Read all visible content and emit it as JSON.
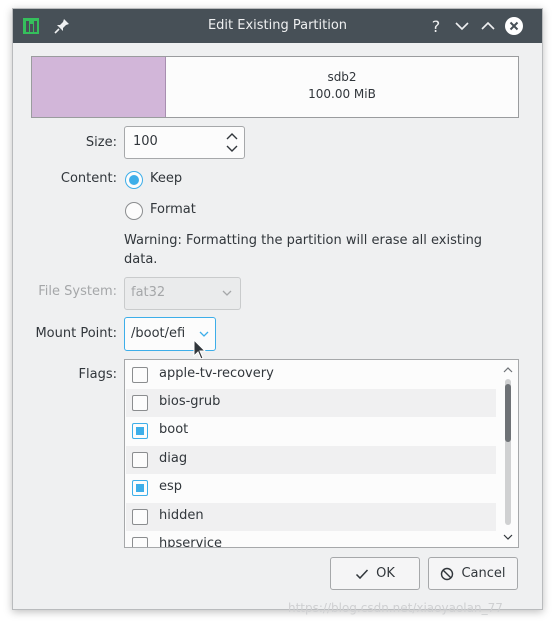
{
  "window": {
    "title": "Edit Existing Partition",
    "help": "?"
  },
  "partition": {
    "name": "sdb2",
    "size_label": "100.00 MiB",
    "fill_fraction": 0.27,
    "fill_color": "#d2b6d9"
  },
  "size": {
    "label": "Size:",
    "value": "100"
  },
  "content": {
    "label": "Content:",
    "options": [
      {
        "label": "Keep",
        "checked": true
      },
      {
        "label": "Format",
        "checked": false
      }
    ],
    "warning": "Warning: Formatting the partition will erase all existing data."
  },
  "file_system": {
    "label": "File System:",
    "value": "fat32"
  },
  "mount_point": {
    "label": "Mount Point:",
    "value": "/boot/efi"
  },
  "flags": {
    "label": "Flags:",
    "items": [
      {
        "label": "apple-tv-recovery",
        "checked": false
      },
      {
        "label": "bios-grub",
        "checked": false
      },
      {
        "label": "boot",
        "checked": true
      },
      {
        "label": "diag",
        "checked": false
      },
      {
        "label": "esp",
        "checked": true
      },
      {
        "label": "hidden",
        "checked": false
      },
      {
        "label": "hpservice",
        "checked": false
      }
    ]
  },
  "buttons": {
    "ok": "OK",
    "cancel": "Cancel"
  },
  "watermark": "https://blog.csdn.net/xiaoyaolan_77",
  "colors": {
    "accent": "#3daee9",
    "titlebar": "#475057",
    "close": "#ffffff"
  }
}
